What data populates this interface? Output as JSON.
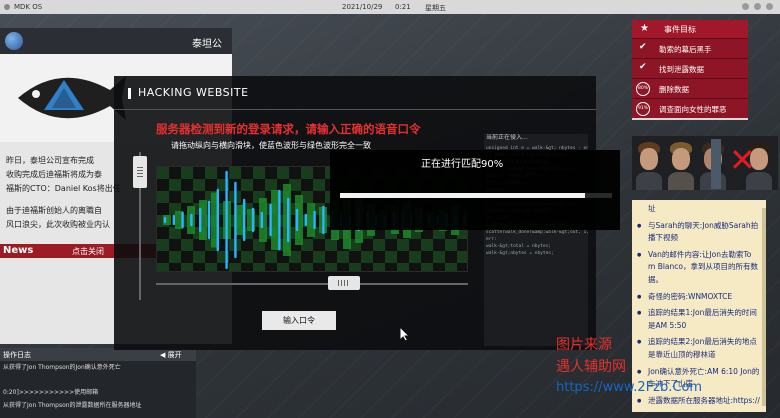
{
  "topbar": {
    "os_name": "MDK OS",
    "date": "2021/10/29",
    "time": "0:21",
    "weekday": "星期五"
  },
  "news": {
    "title": "泰坦公",
    "article": [
      "昨日，泰坦公司宣布完成",
      "收购完成后迪福斯将成为泰",
      "福斯的CTO：Daniel Kos将出任",
      "由于迪福斯创始人的离職自",
      "风口浪尖，此次收购被业内认"
    ],
    "section_label": "News",
    "close_label": "点击关闭"
  },
  "log": {
    "title": "操作日志",
    "expand_label": "展开",
    "lines": [
      "从获得了Jon Thompson的Jon确认意外死亡",
      "0:20]>>>>>>>>>>>使用邮箱",
      "从获得了Jon Thompson的泄露数据所在服务器地址"
    ]
  },
  "objectives": {
    "title": "事件目标",
    "items": [
      {
        "status": "check",
        "label": "勒索的幕后黑手"
      },
      {
        "status": "check",
        "label": "找到泄露数据"
      },
      {
        "status": "80%",
        "label": "删除数据"
      },
      {
        "status": "91%",
        "label": "调查面向女性的罪恶"
      }
    ]
  },
  "notes": {
    "items": [
      {
        "text": "址",
        "bullet": false
      },
      {
        "text": "与Sarah的聊天:Jon威胁Sarah拍",
        "bullet": true
      },
      {
        "text": "播下视频",
        "bullet": false
      },
      {
        "text": "Van的邮件内容:让Jon去勒索To",
        "bullet": true
      },
      {
        "text": "m Blanco，拿到从项目的所有数",
        "bullet": false
      },
      {
        "text": "据。",
        "bullet": false
      },
      {
        "text": "奇怪的密码:WNMOXTCE",
        "bullet": true
      },
      {
        "text": "追踪的结果1:Jon最后消失的时间",
        "bullet": true
      },
      {
        "text": "是AM 5:50",
        "bullet": false
      },
      {
        "text": "追踪的结果2:Jon最后消失的地点",
        "bullet": true
      },
      {
        "text": "是靠近山顶的穆林道",
        "bullet": false
      },
      {
        "text": "Jon确认意外死亡:AM 6:10 Jon的",
        "bullet": true
      },
      {
        "text": "车冲下了山崖",
        "bullet": false
      },
      {
        "text": "泄露数据所在服务器地址:https://",
        "bullet": true
      }
    ]
  },
  "hacking": {
    "title": "HACKING WEBSITE",
    "warning": "服务器检测到新的登录请求，请输入正确的语音口令",
    "instruction": "请拖动纵向与横向滑块，使蓝色波形与绿色波形完全一致",
    "submit_label": "输入口令",
    "vertical_slider_level": 0.1,
    "horizontal_slider_level": 0.6
  },
  "matching": {
    "text": "正在进行匹配90%",
    "progress": 0.9
  },
  "code_panel": {
    "lines": [
      "当前正在侵入...",
      "",
      "unsigned int e = walk-&gt; nbytes - en",
      "// [Walk][Walk-&gt;]&amp;Bamp;",
      "NBLKCIPHER_WALK_SLOW));",
      "c = skllcipher_done_fast(walk,e);",
      "else if (WALK_DIFF)) {",
      "  err = -EINVAL;",
      "  goto err;",
      "} else",
      "  n = skllcipher_done_slow(walk,n);",
      "nbytes = walk-&gt;total - n;",
      "  err = 0;",
      "",
      "scatterwalk_done(&amp;walk-&gt;in, 0, nbytes);",
      "scatterwalk_done(&amp;walk-&gt;out, 1, nbytes);",
      "err:",
      "walk-&gt;total = nbytes;",
      "walk-&gt;nbytes = nbytes;"
    ]
  },
  "watermark": {
    "line1": "图片来源",
    "line2": "遇人辅助网",
    "line3": "https://www.2Fzb.Com"
  },
  "colors": {
    "accent_red": "#a0182a",
    "warning_red": "#e63030",
    "wave_blue": "#28b4ff",
    "wave_green": "#1d8a2a",
    "note_text": "#1a2c80",
    "note_bg": "#f5eac4"
  },
  "icons": {
    "globe": "globe-icon",
    "star": "star-icon",
    "check": "check-icon",
    "cursor": "mouse-cursor-icon",
    "cross": "x-mark-icon"
  }
}
